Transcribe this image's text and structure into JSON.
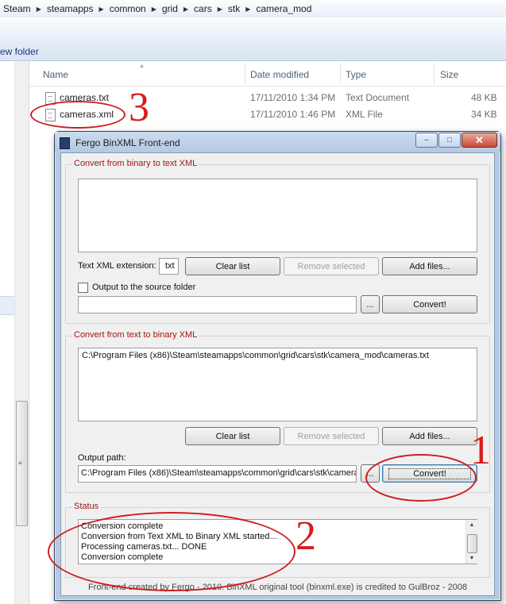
{
  "explorer": {
    "breadcrumb": [
      "Steam",
      "steamapps",
      "common",
      "grid",
      "cars",
      "stk",
      "camera_mod"
    ],
    "new_folder_label": "ew folder",
    "columns": {
      "name": "Name",
      "date_modified": "Date modified",
      "type": "Type",
      "size": "Size"
    },
    "files": [
      {
        "name": "cameras.txt",
        "date": "17/11/2010 1:34 PM",
        "type": "Text Document",
        "size": "48 KB"
      },
      {
        "name": "cameras.xml",
        "date": "17/11/2010 1:46 PM",
        "type": "XML File",
        "size": "34 KB"
      }
    ]
  },
  "annotations": {
    "one": "1",
    "two": "2",
    "three": "3",
    "color": "#d61c1c"
  },
  "dialog": {
    "title": "Fergo BinXML Front-end",
    "caption_buttons": {
      "minimize": "–",
      "maximize": "□",
      "close": "✕"
    },
    "binary_to_text": {
      "group_label": "Convert from binary to text XML",
      "extension_label": "Text XML extension:",
      "extension_value": "txt",
      "clear_list": "Clear list",
      "remove_selected": "Remove selected",
      "add_files": "Add files...",
      "output_source_label": "Output to the source folder",
      "output_path_value": "",
      "browse": "...",
      "convert": "Convert!"
    },
    "text_to_binary": {
      "group_label": "Convert from text to binary XML",
      "files": [
        "C:\\Program Files (x86)\\Steam\\steamapps\\common\\grid\\cars\\stk\\camera_mod\\cameras.txt"
      ],
      "clear_list": "Clear list",
      "remove_selected": "Remove selected",
      "add_files": "Add files...",
      "output_path_label": "Output path:",
      "output_path_value": "C:\\Program Files (x86)\\Steam\\steamapps\\common\\grid\\cars\\stk\\camera",
      "browse": "...",
      "convert": "Convert!"
    },
    "status": {
      "group_label": "Status",
      "lines": [
        "Conversion complete",
        "Conversion from Text XML to Binary XML started...",
        "Processing cameras.txt... DONE",
        "Conversion complete"
      ]
    },
    "credit": "Front-end created by Fergo - 2010. BinXML original tool (binxml.exe) is credited to GulBroz - 2008"
  }
}
